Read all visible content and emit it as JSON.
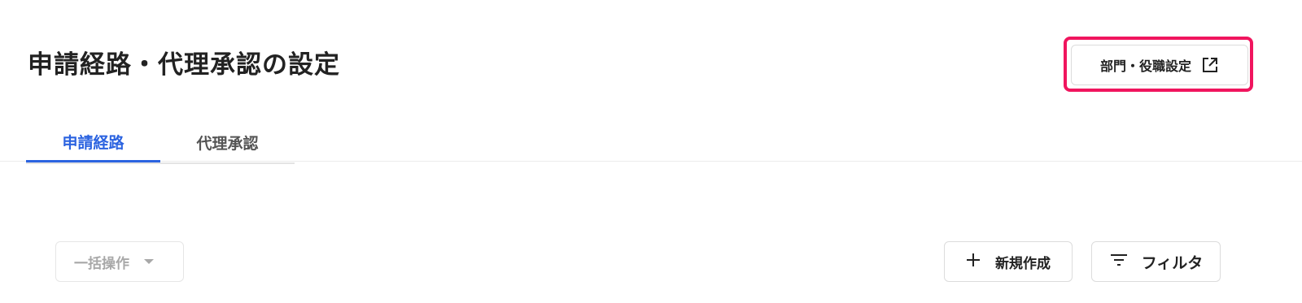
{
  "page": {
    "title": "申請経路・代理承認の設定"
  },
  "header": {
    "dept_button_label": "部門・役職設定",
    "dept_button_icon": "external-link-icon",
    "highlight_color": "#f0155e"
  },
  "tabs": [
    {
      "label": "申請経路",
      "active": true
    },
    {
      "label": "代理承認",
      "active": false
    }
  ],
  "toolbar": {
    "bulk_label": "一括操作",
    "bulk_disabled": true,
    "new_label": "新規作成",
    "new_icon": "plus-icon",
    "filter_label": "フィルタ",
    "filter_icon": "filter-icon"
  },
  "colors": {
    "accent": "#2b63e0",
    "text": "#222222",
    "muted": "#a8a8a8"
  }
}
